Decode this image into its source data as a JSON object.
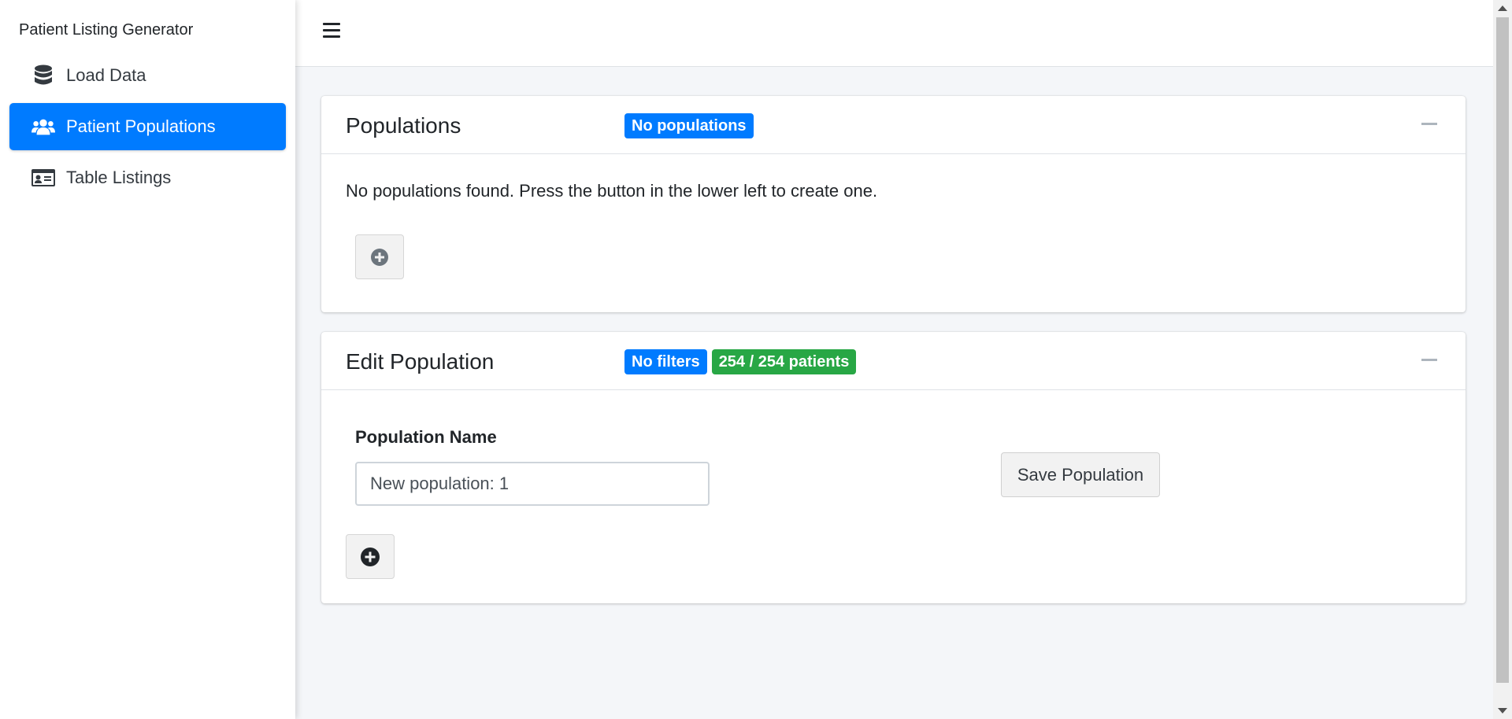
{
  "app": {
    "title": "Patient Listing Generator"
  },
  "sidebar": {
    "items": [
      {
        "label": "Load Data",
        "icon": "database-icon",
        "active": false
      },
      {
        "label": "Patient Populations",
        "icon": "users-icon",
        "active": true
      },
      {
        "label": "Table Listings",
        "icon": "id-card-icon",
        "active": false
      }
    ]
  },
  "populations_card": {
    "title": "Populations",
    "badge": "No populations",
    "empty_message": "No populations found. Press the button in the lower left to create one."
  },
  "edit_card": {
    "title": "Edit Population",
    "badges": {
      "filters": "No filters",
      "patients": "254 / 254 patients"
    },
    "field_label": "Population Name",
    "field_value": "New population: 1",
    "save_label": "Save Population"
  },
  "colors": {
    "primary": "#007bff",
    "success": "#28a745",
    "background": "#f4f6f9"
  }
}
